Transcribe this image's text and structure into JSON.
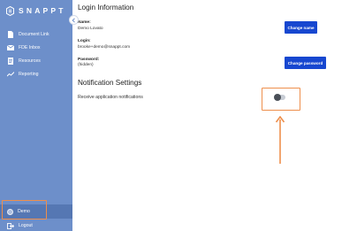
{
  "brand": {
    "name": "SNAPPT",
    "color": "#6d8fca"
  },
  "sidebar": {
    "items": [
      {
        "label": "Document Link",
        "icon": "document-icon"
      },
      {
        "label": "FDE Inbox",
        "icon": "inbox-icon"
      },
      {
        "label": "Resources",
        "icon": "resources-icon"
      },
      {
        "label": "Reporting",
        "icon": "reporting-icon"
      }
    ],
    "user": {
      "label": "Demo",
      "icon": "avatar"
    },
    "logout": {
      "label": "Logout",
      "icon": "logout-icon"
    }
  },
  "login": {
    "title": "Login Information",
    "name_label": "Name:",
    "name_value": "Demo Lovato",
    "change_name_button": "Change name",
    "login_label": "Login:",
    "login_value": "brooke+demo@snappt.com",
    "password_label": "Password:",
    "password_value": "(hidden)",
    "change_password_button": "Change password"
  },
  "notifications": {
    "title": "Notification Settings",
    "receive_label": "Receive application notifications",
    "receive_enabled": false
  },
  "colors": {
    "accent": "#1747d0",
    "highlight": "#ee8f4c",
    "sidebar": "#6d8fca",
    "sidebar_active": "#5577b3"
  }
}
